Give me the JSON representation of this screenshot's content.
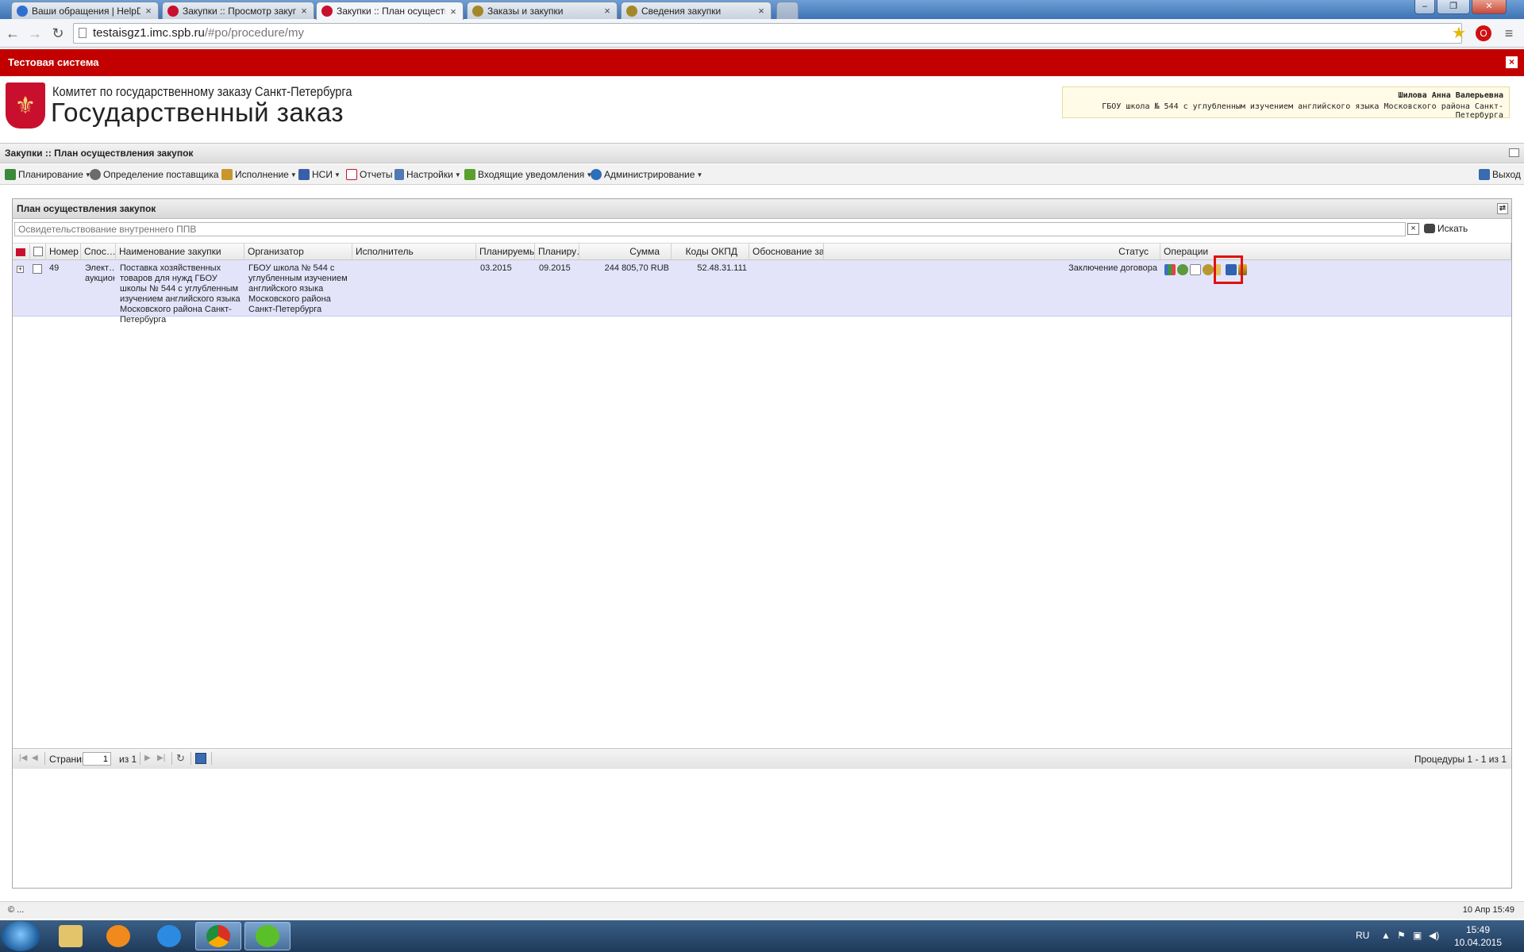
{
  "browser": {
    "tabs": [
      {
        "label": "Ваши обращения | HelpDesk",
        "color": "#2f6fd1"
      },
      {
        "label": "Закупки :: Просмотр закупки",
        "color": "#c8102e"
      },
      {
        "label": "Закупки :: План осуществ",
        "color": "#c8102e",
        "active": true
      },
      {
        "label": "Заказы и закупки",
        "color": "#a4872b"
      },
      {
        "label": "Сведения закупки",
        "color": "#a4872b"
      }
    ],
    "url_host": "testaisgz1.imc.spb.ru",
    "url_path": "/#po/procedure/my"
  },
  "banner": {
    "text": "Тестовая система"
  },
  "header": {
    "org": "Комитет по государственному заказу Санкт-Петербурга",
    "title": "Государственный заказ",
    "user_name": "Шилова Анна Валерьевна",
    "user_org": "ГБОУ школа № 544 с углубленным изучением английского языка Московского района Санкт-Петербурга"
  },
  "module": {
    "breadcrumb": "Закупки :: План осуществления закупок"
  },
  "menu": {
    "items": [
      {
        "label": "Планирование",
        "icon": "planning-icon",
        "color": "#3a8a3a"
      },
      {
        "label": "Определение поставщика",
        "icon": "gears-icon",
        "color": "#6b6b6b"
      },
      {
        "label": "Исполнение",
        "icon": "execution-icon",
        "color": "#c9962c"
      },
      {
        "label": "НСИ",
        "icon": "book-icon",
        "color": "#3a5fa8"
      },
      {
        "label": "Отчеты",
        "icon": "report-icon",
        "color": "#c8102e"
      },
      {
        "label": "Настройки",
        "icon": "wrench-icon",
        "color": "#4f7ab3"
      },
      {
        "label": "Входящие уведомления",
        "icon": "inbox-icon",
        "color": "#5aa02c"
      },
      {
        "label": "Администрирование",
        "icon": "admin-icon",
        "color": "#2d6fb8"
      }
    ],
    "logout": "Выход"
  },
  "panel": {
    "title": "План осуществления закупок",
    "search_placeholder": "Освидетельствование внутреннего ППВ",
    "search_button": "Искать"
  },
  "grid": {
    "columns": [
      "Номер",
      "Спос…",
      "Наименование закупки",
      "Организатор",
      "Исполнитель",
      "Планируемы…",
      "Планиру…",
      "Сумма",
      "Коды ОКПД",
      "Обоснование зак…",
      "Статус",
      "Операции"
    ],
    "rows": [
      {
        "number": "49",
        "method": "Элект… аукцион",
        "name": "Поставка хозяйственных товаров для нужд ГБОУ школы № 544 с углубленным изучением английского языка Московского района Санкт-Петербурга",
        "organizer": "ГБОУ школа № 544 с углубленным изучением английского языка Московского района Санкт-Петербурга",
        "executor": "",
        "planned_start": "03.2015",
        "planned_end": "09.2015",
        "sum": "244 805,70 RUB",
        "okpd": "52.48.31.111",
        "justification": "",
        "status": "Заключение договора"
      }
    ]
  },
  "pager": {
    "page_label": "Страница",
    "page_value": "1",
    "of_label": "из 1",
    "summary": "Процедуры 1 - 1 из 1"
  },
  "statusbar": {
    "left": "© ...",
    "right": "10 Апр 15:49"
  },
  "taskbar": {
    "lang": "RU",
    "time": "15:49",
    "date": "10.04.2015"
  }
}
